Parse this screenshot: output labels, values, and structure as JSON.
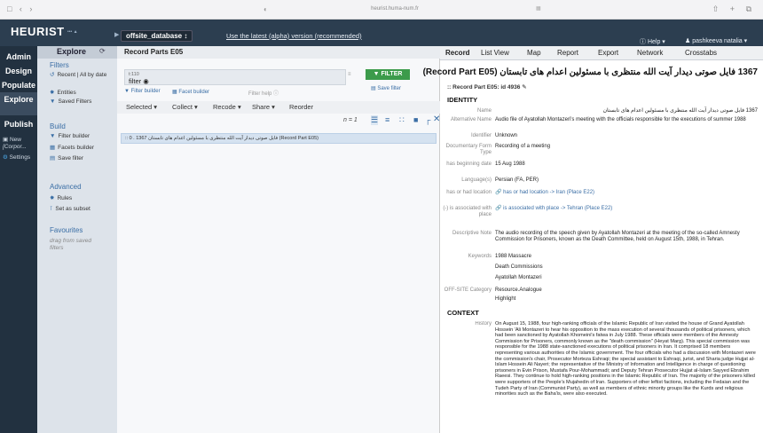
{
  "browser": {
    "nav_glyphs": "□ ‹ ›",
    "url": "heurist.huma-num.fr",
    "right_glyphs": "⇧ + ⧉"
  },
  "header": {
    "logo": "HEURIST",
    "db_name": "offsite_database",
    "latest_link": "Use the latest (alpha) version (recommended)",
    "help": "Help",
    "user": "pashkeeva natalia"
  },
  "left_menu": {
    "admin": "Admin",
    "design": "Design",
    "populate": "Populate",
    "explore": "Explore",
    "publish": "Publish",
    "new": "New",
    "corpus": "[Corpor...",
    "settings": "Settings"
  },
  "filters": {
    "tab_label": "Explore",
    "filters_head": "Filters",
    "recent_all": "Recent | All by date",
    "entities": "Entities",
    "saved_filters": "Saved Filters",
    "build_head": "Build",
    "filter_builder": "Filter builder",
    "facets_builder": "Facets builder",
    "save_filter": "Save filter",
    "advanced_head": "Advanced",
    "rules": "Rules",
    "set_as_subset": "Set as subset",
    "favourites_head": "Favourites",
    "favourites_note": "drag from saved filters"
  },
  "results": {
    "title": "Record Parts E05",
    "search_value": "filter",
    "search_small": "t:110",
    "filter_button": "FILTER",
    "filter_builder_link": "Filter builder",
    "facet_builder_link": "Facet builder",
    "filter_help": "Filter help",
    "save_filter": "Save filter",
    "actions": {
      "selected": "Selected",
      "collect": "Collect",
      "recode": "Recode",
      "share": "Share",
      "reorder": "Reorder"
    },
    "count": "n = 1",
    "row_text": ":: 0 . 1367 فایل صوتی دیدار آیت الله منتظری با مسئولین اعدام های تابستان (Record Part E05)"
  },
  "record": {
    "tabs": [
      "Record",
      "List View",
      "Map",
      "Report",
      "Export",
      "Network",
      "Crosstabs"
    ],
    "title": "1367 فایل صوتی دیدار آیت الله منتظری با مسئولین اعدام های تابستان (Record Part E05)",
    "id_line": "Record Part E05: id 4936",
    "identity_head": "IDENTITY",
    "context_head": "CONTEXT",
    "fields": {
      "name_label": "Name",
      "name_value": "1367 فایل صوتی دیدار آیت الله منتظری با مسئولین اعدام های تابستان",
      "alt_label": "Alternative Name",
      "alt_value": "Audio file of Ayatollah Montazeri's meeting with the officials responsible for the executions of summer 1988",
      "identifier_label": "Identifier",
      "identifier_value": "Unknown",
      "form_label": "Documentary Form Type",
      "form_value": "Recording of a meeting",
      "date_label": "has beginning date",
      "date_value": "15 Aug 1988",
      "lang_label": "Language(s)",
      "lang_value": "Persian (FA, PER)",
      "loc_label": "has or had location",
      "loc_value": "has or had location -> Iran (Place E22)",
      "assoc_label": "(-) is associated with place",
      "assoc_value": "is associated with place -> Tehran (Place E22)",
      "desc_label": "Descriptive Note",
      "desc_value": "The audio recording of the speech given by Ayatollah Montazeri at the meeting of the so-called Amnesty Commission for Prisoners, known as the Death Committee, held on August 15th, 1988, in Tehran.",
      "kw_label": "Keywords",
      "kw_values": [
        "1988 Massacre",
        "Death Commissions",
        "Ayatollah Montazeri"
      ],
      "cat_label": "OFF-SITE Category",
      "cat_values": [
        "Resource.Analogue",
        "Highlight"
      ],
      "history_label": "History",
      "history_value": "On August 15, 1988, four high-ranking officials of the Islamic Republic of Iran visited the house of Grand Ayatollah Hossein 'Ali Montazeri to hear his opposition to the mass execution of several thousands of political prisoners, which had been sanctioned by Ayatollah Khomeini's fatwa in July 1988. These officials were members of the Amnesty Commission for Prisoners, commonly known as the \"death commission\" (Heyat Marg). This special commission was responsible for the 1988 state-sanctioned executions of political prisoners in Iran. It comprised 18 members representing various authorities of the Islamic government. The four officials who had a discussion with Montazeri were the commission's chair, Prosecutor Morteza Eshraqi; the special assistant to Eshraqi, jurist, and Sharia judge Hujjat al-Islam Hossein Ali Nayeri; the representative of the Ministry of Information and Intelligence in charge of questioning prisoners in Evin Prison, Mustafa Pour-Mohammadi; and Deputy Tehran Prosecutor Hujjat al-Islam Sayyed Ebrahim Raeesi. They continue to hold high-ranking positions in the Islamic Republic of Iran. The majority of the prisoners killed were supporters of the People's Mujahedin of Iran. Supporters of other leftist factions, including the Fedaian and the Tudeh Party of Iran (Communist Party), as well as members of ethnic minority groups like the Kurds and religious minorities such as the Baha'is, were also executed."
    }
  }
}
